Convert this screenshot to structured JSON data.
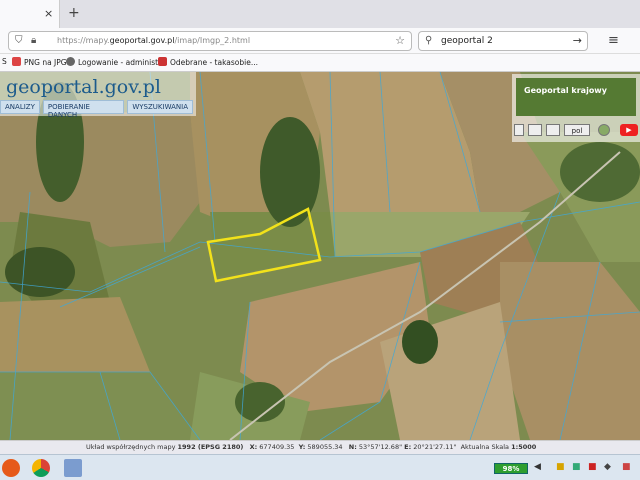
{
  "browser": {
    "tab_close": "×",
    "new_tab": "+",
    "url_prefix": "https://mapy.",
    "url_domain": "geoportal.gov.pl",
    "url_path": "/imap/Imgp_2.html",
    "search_text": "geoportal 2",
    "bookmarks": [
      "S",
      "PNG na JPG",
      "Logowanie - administr...",
      "Odebrane - takasobie..."
    ]
  },
  "map": {
    "logo_text": "geoportal.gov.pl",
    "menu": [
      "ANALIZY",
      "POBIERANIE DANYCH",
      "WYSZUKIWANIA"
    ],
    "overview_label": "Geoportal krajowy",
    "language_select": "pol",
    "parcel_outline_color": "#f2e21a"
  },
  "status": {
    "label": "Układ współrzędnych mapy",
    "crs": "1992 (EPSG 2180)",
    "x_label": "X:",
    "x": "677409.35",
    "y_label": "Y:",
    "y": "589055.34",
    "n_label": "N:",
    "n": "53°57'12.68\"",
    "e_label": "E:",
    "e": "20°21'27.11\"",
    "scale_label": "Aktualna Skala",
    "scale": "1:5000"
  },
  "taskbar": {
    "battery": "98%"
  }
}
